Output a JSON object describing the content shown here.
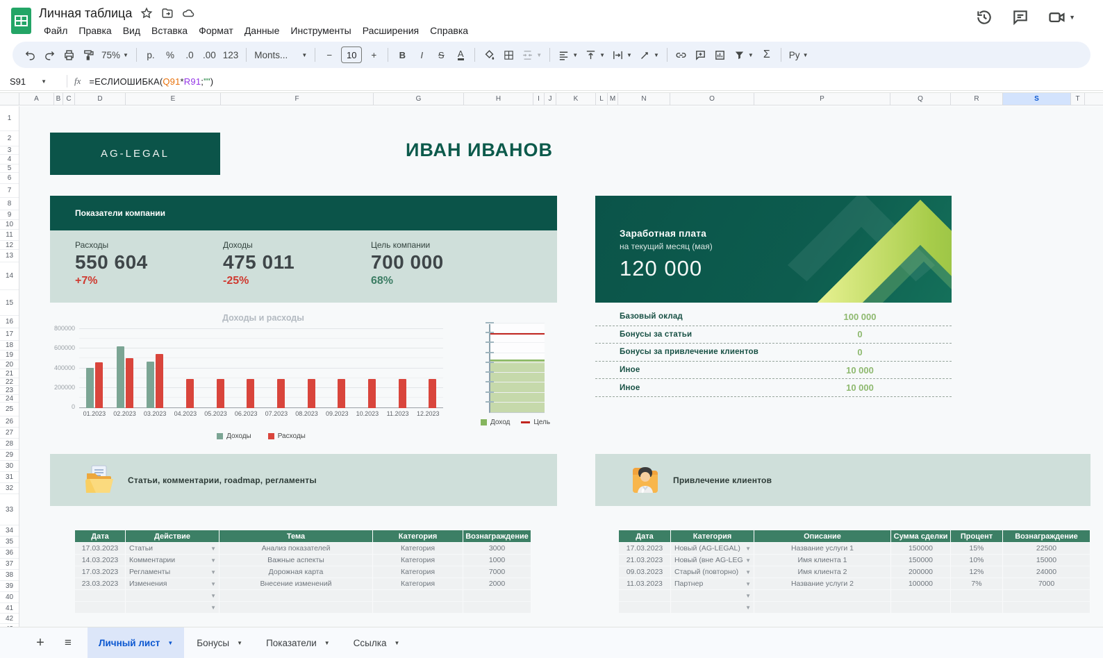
{
  "app": {
    "title": "Личная таблица",
    "menus": [
      "Файл",
      "Правка",
      "Вид",
      "Вставка",
      "Формат",
      "Данные",
      "Инструменты",
      "Расширения",
      "Справка"
    ]
  },
  "toolbar": {
    "zoom": "75%",
    "currency_label": "р.",
    "percent_label": "%",
    "decrease_decimal_label": ".0",
    "increase_decimal_label": ".00",
    "number_format_label": "123",
    "font_name": "Monts...",
    "font_size": "10",
    "minus_label": "−",
    "plus_label": "+",
    "bold_label": "B",
    "italic_label": "I",
    "strikethrough_label": "S",
    "text_color_label": "A",
    "sum_label": "Σ",
    "input_tools_label": "Ру"
  },
  "formula_bar": {
    "cell_ref": "S91",
    "fx_label": "fx",
    "formula_parts": [
      {
        "text": "=ЕСЛИОШИБКА(",
        "color": "#202124"
      },
      {
        "text": "Q91",
        "color": "#e8710a"
      },
      {
        "text": "*",
        "color": "#202124"
      },
      {
        "text": "R91",
        "color": "#9334e6"
      },
      {
        "text": ";",
        "color": "#202124"
      },
      {
        "text": "\"\"",
        "color": "#188038"
      },
      {
        "text": ")",
        "color": "#202124"
      }
    ]
  },
  "grid": {
    "columns": [
      "A",
      "B",
      "C",
      "D",
      "E",
      "F",
      "G",
      "H",
      "I",
      "J",
      "K",
      "L",
      "M",
      "N",
      "O",
      "P",
      "Q",
      "R",
      "S",
      "T"
    ],
    "selected_column": "S",
    "row_count": 43
  },
  "sheet": {
    "logo_text": "AG-LEGAL",
    "owner_name": "ИВАН ИВАНОВ",
    "metrics_panel": {
      "title": "Показатели компании",
      "items": [
        {
          "label": "Расходы",
          "value": "550 604",
          "delta": "+7%",
          "delta_color": "#cf3a30"
        },
        {
          "label": "Доходы",
          "value": "475 011",
          "delta": "-25%",
          "delta_color": "#cf3a30"
        },
        {
          "label": "Цель компании",
          "value": "700 000",
          "delta": "68%",
          "delta_color": "#3c7d64"
        }
      ]
    },
    "salary_panel": {
      "title": "Заработная плата",
      "subtitle": "на текущий месяц (мая)",
      "amount": "120 000"
    },
    "salary_breakdown": [
      {
        "label": "Базовый оклад",
        "value": "100 000"
      },
      {
        "label": "Бонусы за статьи",
        "value": "0"
      },
      {
        "label": "Бонусы за привлечение клиентов",
        "value": "0"
      },
      {
        "label": "Иное",
        "value": "10 000"
      },
      {
        "label": "Иное",
        "value": "10 000"
      }
    ],
    "articles_section": {
      "title": "Статьи, комментарии, roadmap, регламенты",
      "table": {
        "headers": [
          "Дата",
          "Действие",
          "Тема",
          "Категория",
          "Вознаграждение"
        ],
        "rows": [
          [
            "17.03.2023",
            "Статьи",
            "Анализ показателей",
            "Категория",
            "3000"
          ],
          [
            "14.03.2023",
            "Комментарии",
            "Важные аспекты",
            "Категория",
            "1000"
          ],
          [
            "17.03.2023",
            "Регламенты",
            "Дорожная карта",
            "Категория",
            "7000"
          ],
          [
            "23.03.2023",
            "Изменения",
            "Внесение изменений",
            "Категория",
            "2000"
          ],
          [
            "",
            "",
            "",
            "",
            ""
          ],
          [
            "",
            "",
            "",
            "",
            ""
          ]
        ]
      }
    },
    "clients_section": {
      "title": "Привлечение клиентов",
      "table": {
        "headers": [
          "Дата",
          "Категория",
          "Описание",
          "Сумма сделки",
          "Процент",
          "Вознаграждение"
        ],
        "rows": [
          [
            "17.03.2023",
            "Новый (AG-LEGAL)",
            "Название услуги 1",
            "150000",
            "15%",
            "22500"
          ],
          [
            "21.03.2023",
            "Новый (вне AG-LEG",
            "Имя клиента 1",
            "150000",
            "10%",
            "15000"
          ],
          [
            "09.03.2023",
            "Старый (повторно)",
            "Имя клиента 2",
            "200000",
            "12%",
            "24000"
          ],
          [
            "11.03.2023",
            "Партнер",
            "Название услуги 2",
            "100000",
            "7%",
            "7000"
          ],
          [
            "",
            "",
            "",
            "",
            "",
            ""
          ],
          [
            "",
            "",
            "",
            "",
            "",
            ""
          ]
        ]
      }
    }
  },
  "chart_data": [
    {
      "type": "bar",
      "title": "Доходы и расходы",
      "categories": [
        "01.2023",
        "02.2023",
        "03.2023",
        "04.2023",
        "05.2023",
        "06.2023",
        "07.2023",
        "08.2023",
        "09.2023",
        "10.2023",
        "11.2023",
        "12.2023"
      ],
      "series": [
        {
          "name": "Доходы",
          "color": "#7ba594",
          "values": [
            410000,
            630000,
            475000,
            0,
            0,
            0,
            0,
            0,
            0,
            0,
            0,
            0
          ]
        },
        {
          "name": "Расходы",
          "color": "#d9453c",
          "values": [
            465000,
            510000,
            550000,
            300000,
            300000,
            300000,
            300000,
            300000,
            300000,
            300000,
            300000,
            300000
          ]
        }
      ],
      "xlabel": "",
      "ylabel": "",
      "ylim": [
        0,
        800000
      ],
      "yticks": [
        0,
        200000,
        400000,
        600000,
        800000
      ],
      "grid": true,
      "legend_position": "bottom"
    },
    {
      "type": "area",
      "title": "",
      "series": [
        {
          "name": "Доход",
          "color": "#85b55e",
          "values": [
            475011
          ]
        },
        {
          "name": "Цель",
          "color": "#c1251f",
          "values": [
            700000
          ]
        }
      ],
      "ylim": [
        0,
        800000
      ],
      "legend_position": "bottom"
    }
  ],
  "tabs": [
    {
      "label": "Личный лист",
      "active": true
    },
    {
      "label": "Бонусы",
      "active": false
    },
    {
      "label": "Показатели",
      "active": false
    },
    {
      "label": "Ссылка",
      "active": false
    }
  ],
  "colors": {
    "brand_teal": "#0b5449",
    "light_teal": "#cfdfda",
    "table_header_green": "#3c7f65",
    "negative_red": "#cf3a30",
    "positive_green": "#3c7d64",
    "salary_value_green": "#8eb96f",
    "income_bar": "#7ba594",
    "expense_bar": "#d9453c",
    "active_tab_blue": "#0b57d0"
  }
}
